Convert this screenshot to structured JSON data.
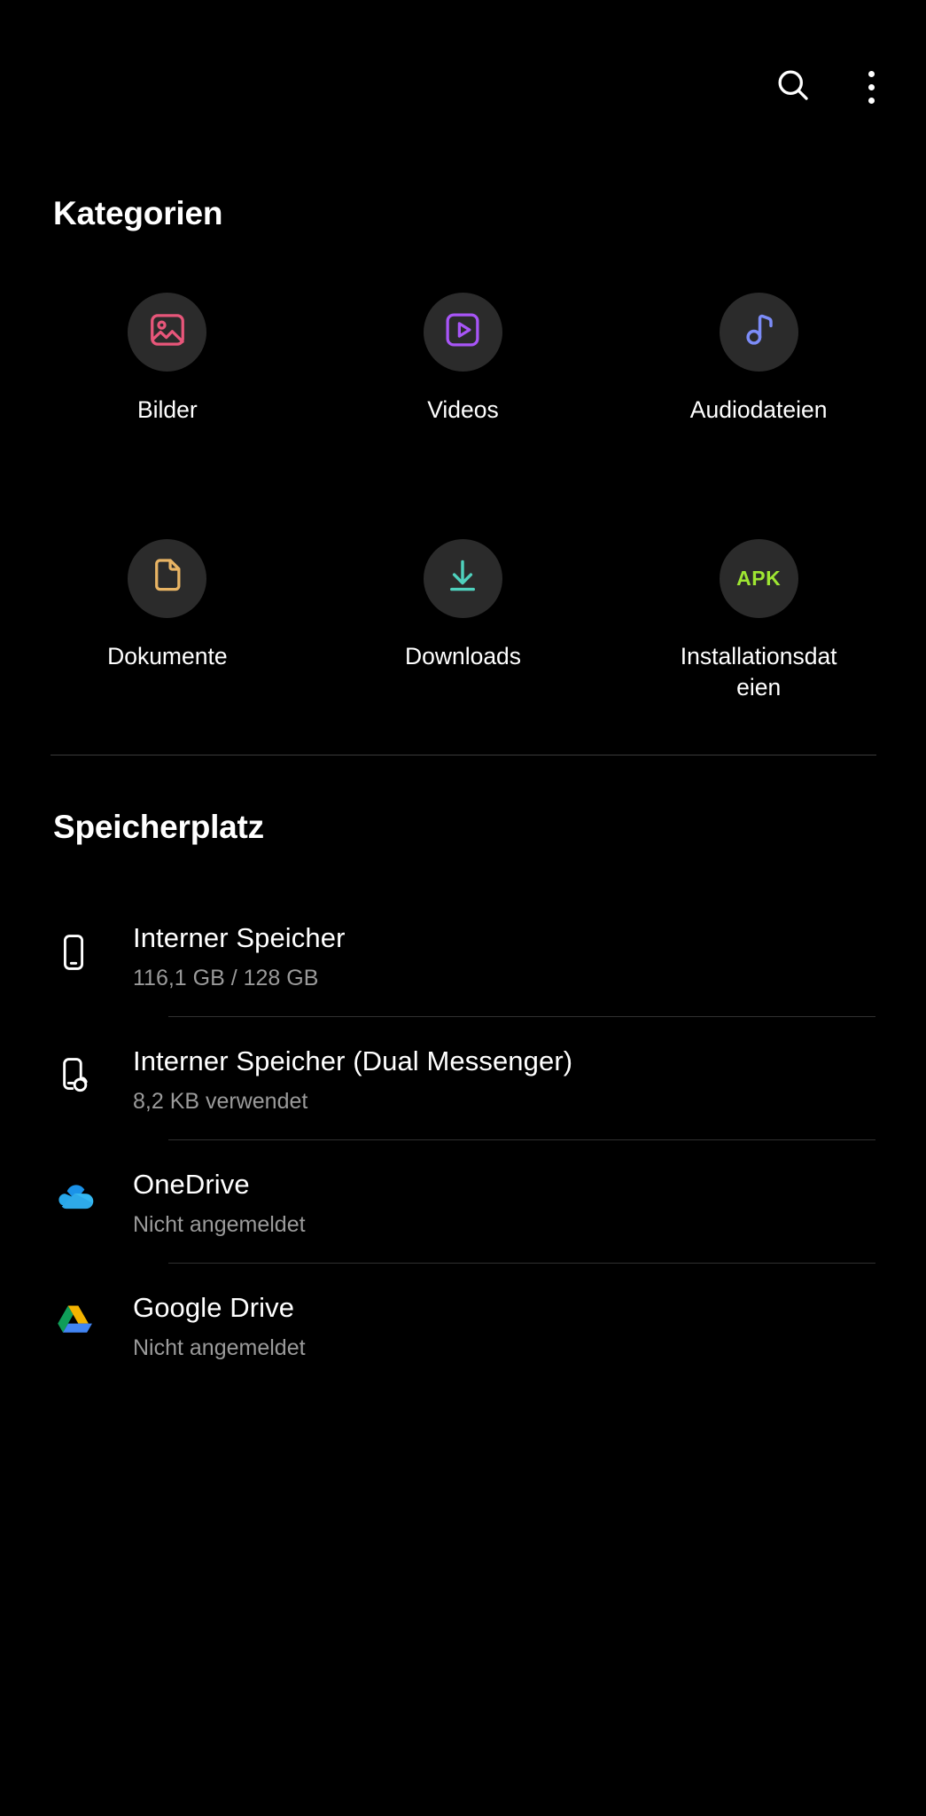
{
  "topbar": {
    "search_icon": "search-icon",
    "more_icon": "more-vert-icon"
  },
  "categories": {
    "title": "Kategorien",
    "items": [
      {
        "label": "Bilder",
        "icon": "image-icon",
        "color": "#e8567a"
      },
      {
        "label": "Videos",
        "icon": "video-icon",
        "color": "#a855f7"
      },
      {
        "label": "Audiodateien",
        "icon": "music-note-icon",
        "color": "#7c8cf8"
      },
      {
        "label": "Dokumente",
        "icon": "document-icon",
        "color": "#e8b464"
      },
      {
        "label": "Downloads",
        "icon": "download-icon",
        "color": "#4fd1bd"
      },
      {
        "label": "Installationsdateien",
        "icon": "apk-icon",
        "color": "#9ee632",
        "badge_text": "APK"
      }
    ]
  },
  "storage": {
    "title": "Speicherplatz",
    "items": [
      {
        "name": "Interner Speicher",
        "sub": "116,1 GB / 128 GB",
        "icon": "phone-icon"
      },
      {
        "name": "Interner Speicher (Dual Messenger)",
        "sub": "8,2 KB verwendet",
        "icon": "phone-dual-icon"
      },
      {
        "name": "OneDrive",
        "sub": "Nicht angemeldet",
        "icon": "onedrive-icon"
      },
      {
        "name": "Google Drive",
        "sub": "Nicht angemeldet",
        "icon": "google-drive-icon"
      }
    ]
  }
}
